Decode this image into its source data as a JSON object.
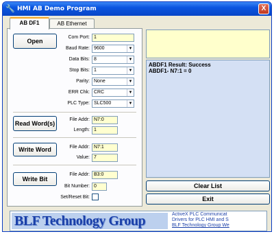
{
  "window": {
    "title": "HMI AB Demo Program",
    "close": "X"
  },
  "tabs": [
    "AB DF1",
    "AB Ethernet"
  ],
  "df1": {
    "open_label": "Open",
    "com_port_label": "Com Port:",
    "com_port_value": "1",
    "baud_rate_label": "Baud Rate:",
    "baud_rate_value": "9600",
    "data_bits_label": "Data Bits:",
    "data_bits_value": "8",
    "stop_bits_label": "Stop Bits:",
    "stop_bits_value": "1",
    "parity_label": "Parity:",
    "parity_value": "None",
    "err_chk_label": "ERR Chk:",
    "err_chk_value": "CRC",
    "plc_type_label": "PLC Type:",
    "plc_type_value": "SLC500",
    "read_label": "Read Word(s)",
    "read_addr_label": "File Addr:",
    "read_addr_value": "N7:0",
    "read_length_label": "Length:",
    "read_length_value": "1",
    "write_word_label": "Write Word",
    "write_addr_label": "File Addr:",
    "write_addr_value": "N7:1",
    "write_value_label": "Value:",
    "write_value_value": "7",
    "write_bit_label": "Write Bit",
    "bit_addr_label": "File Addr:",
    "bit_addr_value": "B3:0",
    "bit_number_label": "Bit Number:",
    "bit_number_value": "0",
    "set_reset_label": "Set/Reset Bit:"
  },
  "result": {
    "line1": "ABDF1 Result: Success",
    "line2": "ABDF1- N7:1 = 0"
  },
  "clear_list_label": "Clear List",
  "exit_label": "Exit",
  "banner": {
    "logo": "BLF Technology Group",
    "line1": "ActiveX PLC Communicat",
    "line2": "Drivers for PLC HMI and S",
    "line3": "BLF Technology Group We"
  },
  "colors": {
    "title_bar": "#0a55e0",
    "field_bg": "#ffffd0",
    "result_bg": "#d4e0f4",
    "logo": "#1a3fa8"
  },
  "icons": {
    "app": "wrench-icon",
    "close": "close-icon",
    "dropdown": "chevron-down-icon"
  }
}
